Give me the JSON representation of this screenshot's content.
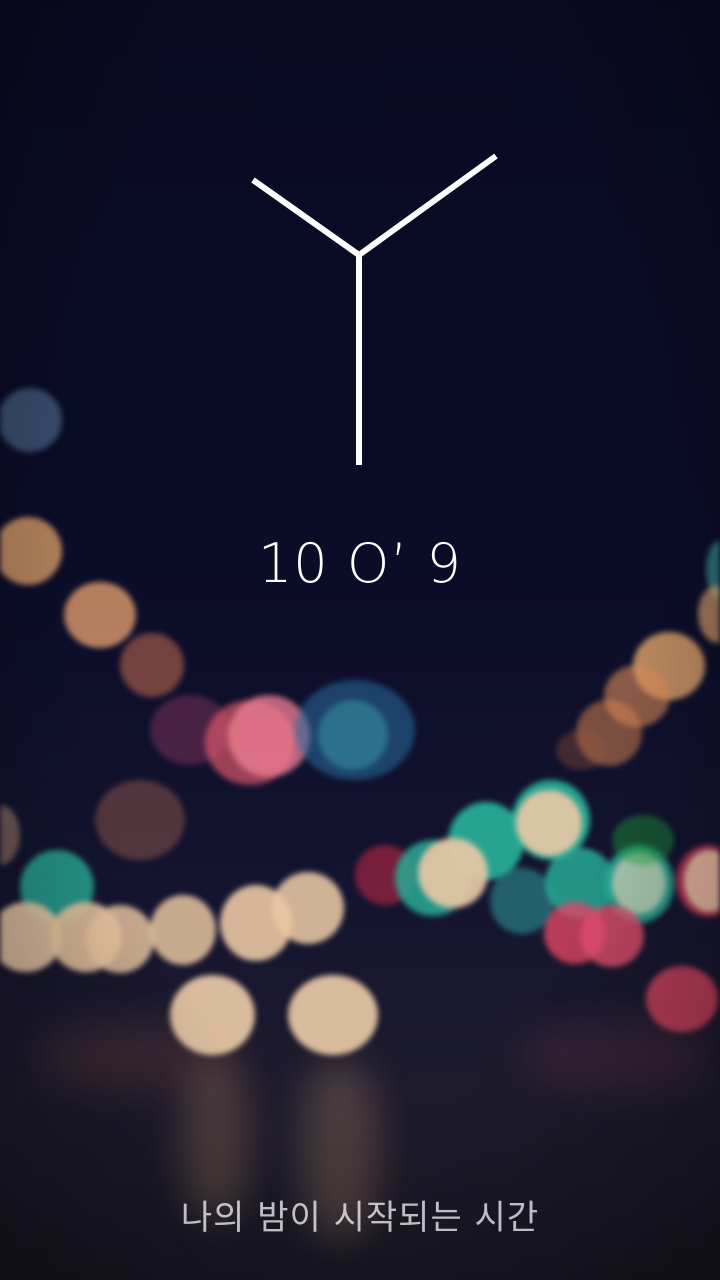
{
  "lockscreen": {
    "time_display": "10 O’ 9",
    "tagline": "나의 밤이 시작되는 시간",
    "clock_icon": "y-shaped-clock-hands-icon",
    "colors": {
      "background": "#0a0b24",
      "foreground": "#ffffff",
      "bokeh_warm": "#e8b88a",
      "bokeh_teal": "#2fb8a0",
      "bokeh_pink": "#e8456a"
    }
  }
}
